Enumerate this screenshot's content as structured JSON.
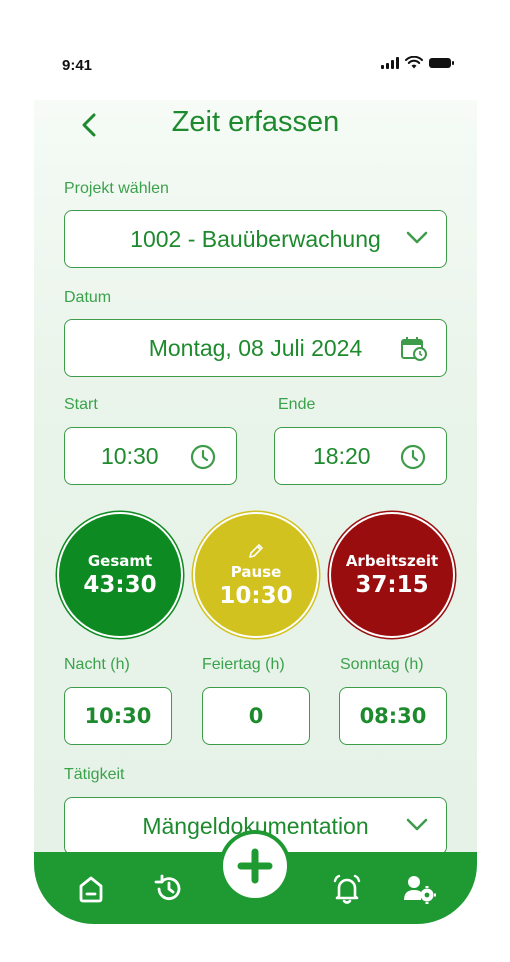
{
  "status_bar": {
    "time": "9:41"
  },
  "header": {
    "title": "Zeit erfassen"
  },
  "project": {
    "label": "Projekt wählen",
    "value": "1002 - Bauüberwachung"
  },
  "date": {
    "label": "Datum",
    "value": "Montag, 08 Juli 2024"
  },
  "start": {
    "label": "Start",
    "value": "10:30"
  },
  "end": {
    "label": "Ende",
    "value": "18:20"
  },
  "summary": [
    {
      "label": "Gesamt",
      "value": "43:30",
      "color": "#0d8a21"
    },
    {
      "label": "Pause",
      "value": "10:30",
      "color": "#d2c21f"
    },
    {
      "label": "Arbeitszeit",
      "value": "37:15",
      "color": "#9a0d0f"
    }
  ],
  "extras": [
    {
      "label": "Nacht (h)",
      "value": "10:30"
    },
    {
      "label": "Feiertag (h)",
      "value": "0"
    },
    {
      "label": "Sonntag (h)",
      "value": "08:30"
    }
  ],
  "activity": {
    "label": "Tätigkeit",
    "value": "Mängeldokumentation"
  },
  "nav": {
    "items": [
      "home-icon",
      "history-icon",
      "add-icon",
      "bell-icon",
      "user-settings-icon"
    ],
    "accent": "#1f9a33"
  }
}
